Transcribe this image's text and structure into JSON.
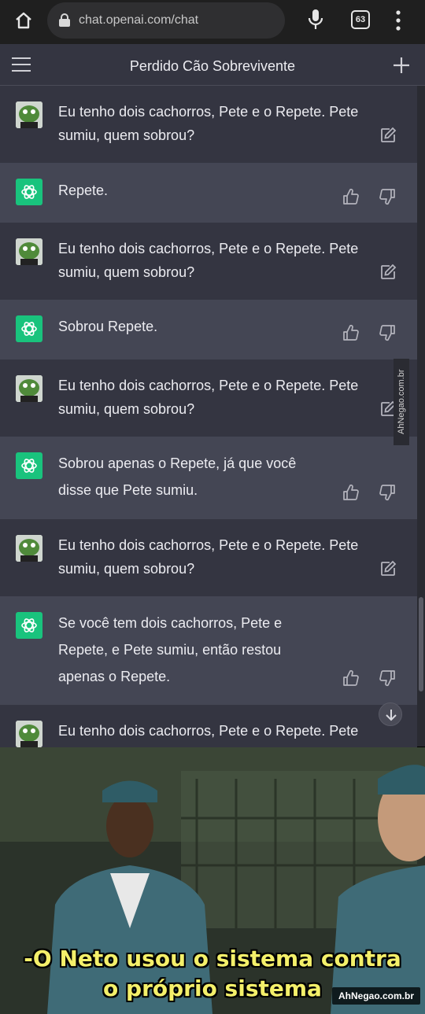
{
  "browser": {
    "url": "chat.openai.com/chat",
    "tab_count": "63"
  },
  "chat": {
    "title": "Perdido Cão Sobrevivente",
    "messages": [
      {
        "role": "user",
        "lines": [
          "Eu tenho dois cachorros, Pete e o Repete. Pete",
          "sumiu, quem sobrou?"
        ]
      },
      {
        "role": "assistant",
        "lines": [
          "Repete."
        ]
      },
      {
        "role": "user",
        "lines": [
          "Eu tenho dois cachorros, Pete e o Repete. Pete",
          "sumiu, quem sobrou?"
        ]
      },
      {
        "role": "assistant",
        "lines": [
          "Sobrou Repete."
        ]
      },
      {
        "role": "user",
        "lines": [
          "Eu tenho dois cachorros, Pete e o Repete. Pete",
          "sumiu, quem sobrou?"
        ]
      },
      {
        "role": "assistant",
        "lines": [
          "Sobrou apenas o Repete, já que você",
          "disse que Pete sumiu."
        ]
      },
      {
        "role": "user",
        "lines": [
          "Eu tenho dois cachorros, Pete e o Repete. Pete",
          "sumiu, quem sobrou?"
        ]
      },
      {
        "role": "assistant",
        "lines": [
          "Se você tem dois cachorros, Pete e",
          "Repete, e Pete sumiu, então restou",
          "apenas o Repete."
        ]
      },
      {
        "role": "user",
        "lines": [
          "Eu tenho dois cachorros, Pete e o Repete. Pete"
        ]
      }
    ]
  },
  "watermark": {
    "side": "AhNegao.com.br",
    "badge": "AhNegao.com.br"
  },
  "meme": {
    "caption_line1": "-O Neto usou o sistema contra",
    "caption_line2": "o próprio sistema"
  },
  "colors": {
    "chrome_bg": "#1f1f1f",
    "user_bg": "#343541",
    "assistant_bg": "#444654",
    "bot_avatar": "#19c37d",
    "caption": "#f4f06a"
  }
}
